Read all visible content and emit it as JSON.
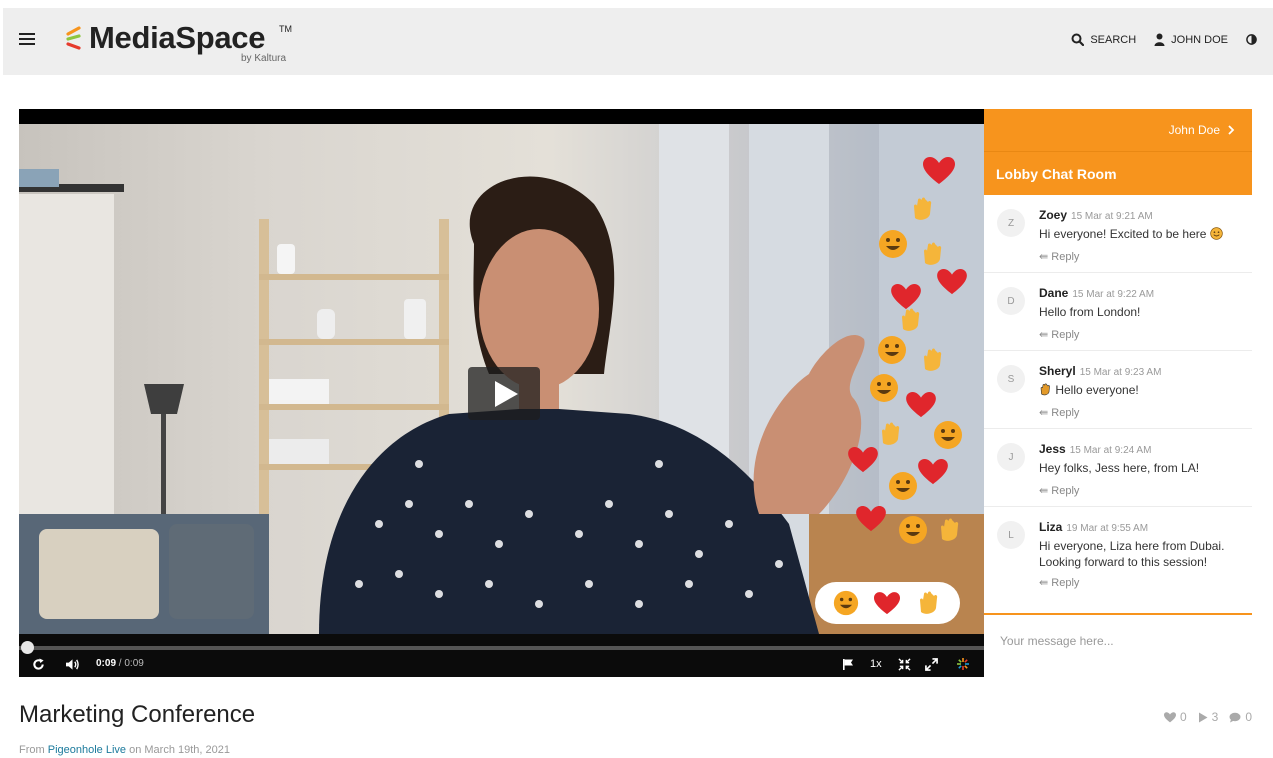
{
  "header": {
    "logo_text": "MediaSpace",
    "logo_tm": "TM",
    "logo_tagline": "by Kaltura",
    "search_label": "SEARCH",
    "user_label": "JOHN DOE"
  },
  "player": {
    "current_time": "0:09",
    "duration": "/ 0:09",
    "speed": "1x",
    "progress": 0.0,
    "reaction_buttons": [
      "grinning-face",
      "red-heart",
      "clapping-hands"
    ]
  },
  "chat": {
    "user_link": "John Doe",
    "room_title": "Lobby Chat Room",
    "reply_label": "Reply",
    "input_placeholder": "Your message here...",
    "messages": [
      {
        "initial": "Z",
        "name": "Zoey",
        "time": "15 Mar at 9:21 AM",
        "text": "Hi everyone! Excited to be here"
      },
      {
        "initial": "D",
        "name": "Dane",
        "time": "15 Mar at 9:22 AM",
        "text": "Hello from London!"
      },
      {
        "initial": "S",
        "name": "Sheryl",
        "time": "15 Mar at 9:23 AM",
        "text": "Hello everyone!"
      },
      {
        "initial": "J",
        "name": "Jess",
        "time": "15 Mar at 9:24 AM",
        "text": "Hey folks, Jess here, from LA!"
      },
      {
        "initial": "L",
        "name": "Liza",
        "time": "19 Mar at 9:55 AM",
        "text": "Hi everyone, Liza here from Dubai. Looking forward to this session!"
      }
    ]
  },
  "media": {
    "title": "Marketing Conference",
    "from_prefix": "From",
    "channel": "Pigeonhole Live",
    "date_text": "on March 19th, 2021",
    "likes": "0",
    "plays": "3",
    "comments": "0"
  },
  "colors": {
    "accent": "#f7941d",
    "link": "#1b7a9c"
  }
}
